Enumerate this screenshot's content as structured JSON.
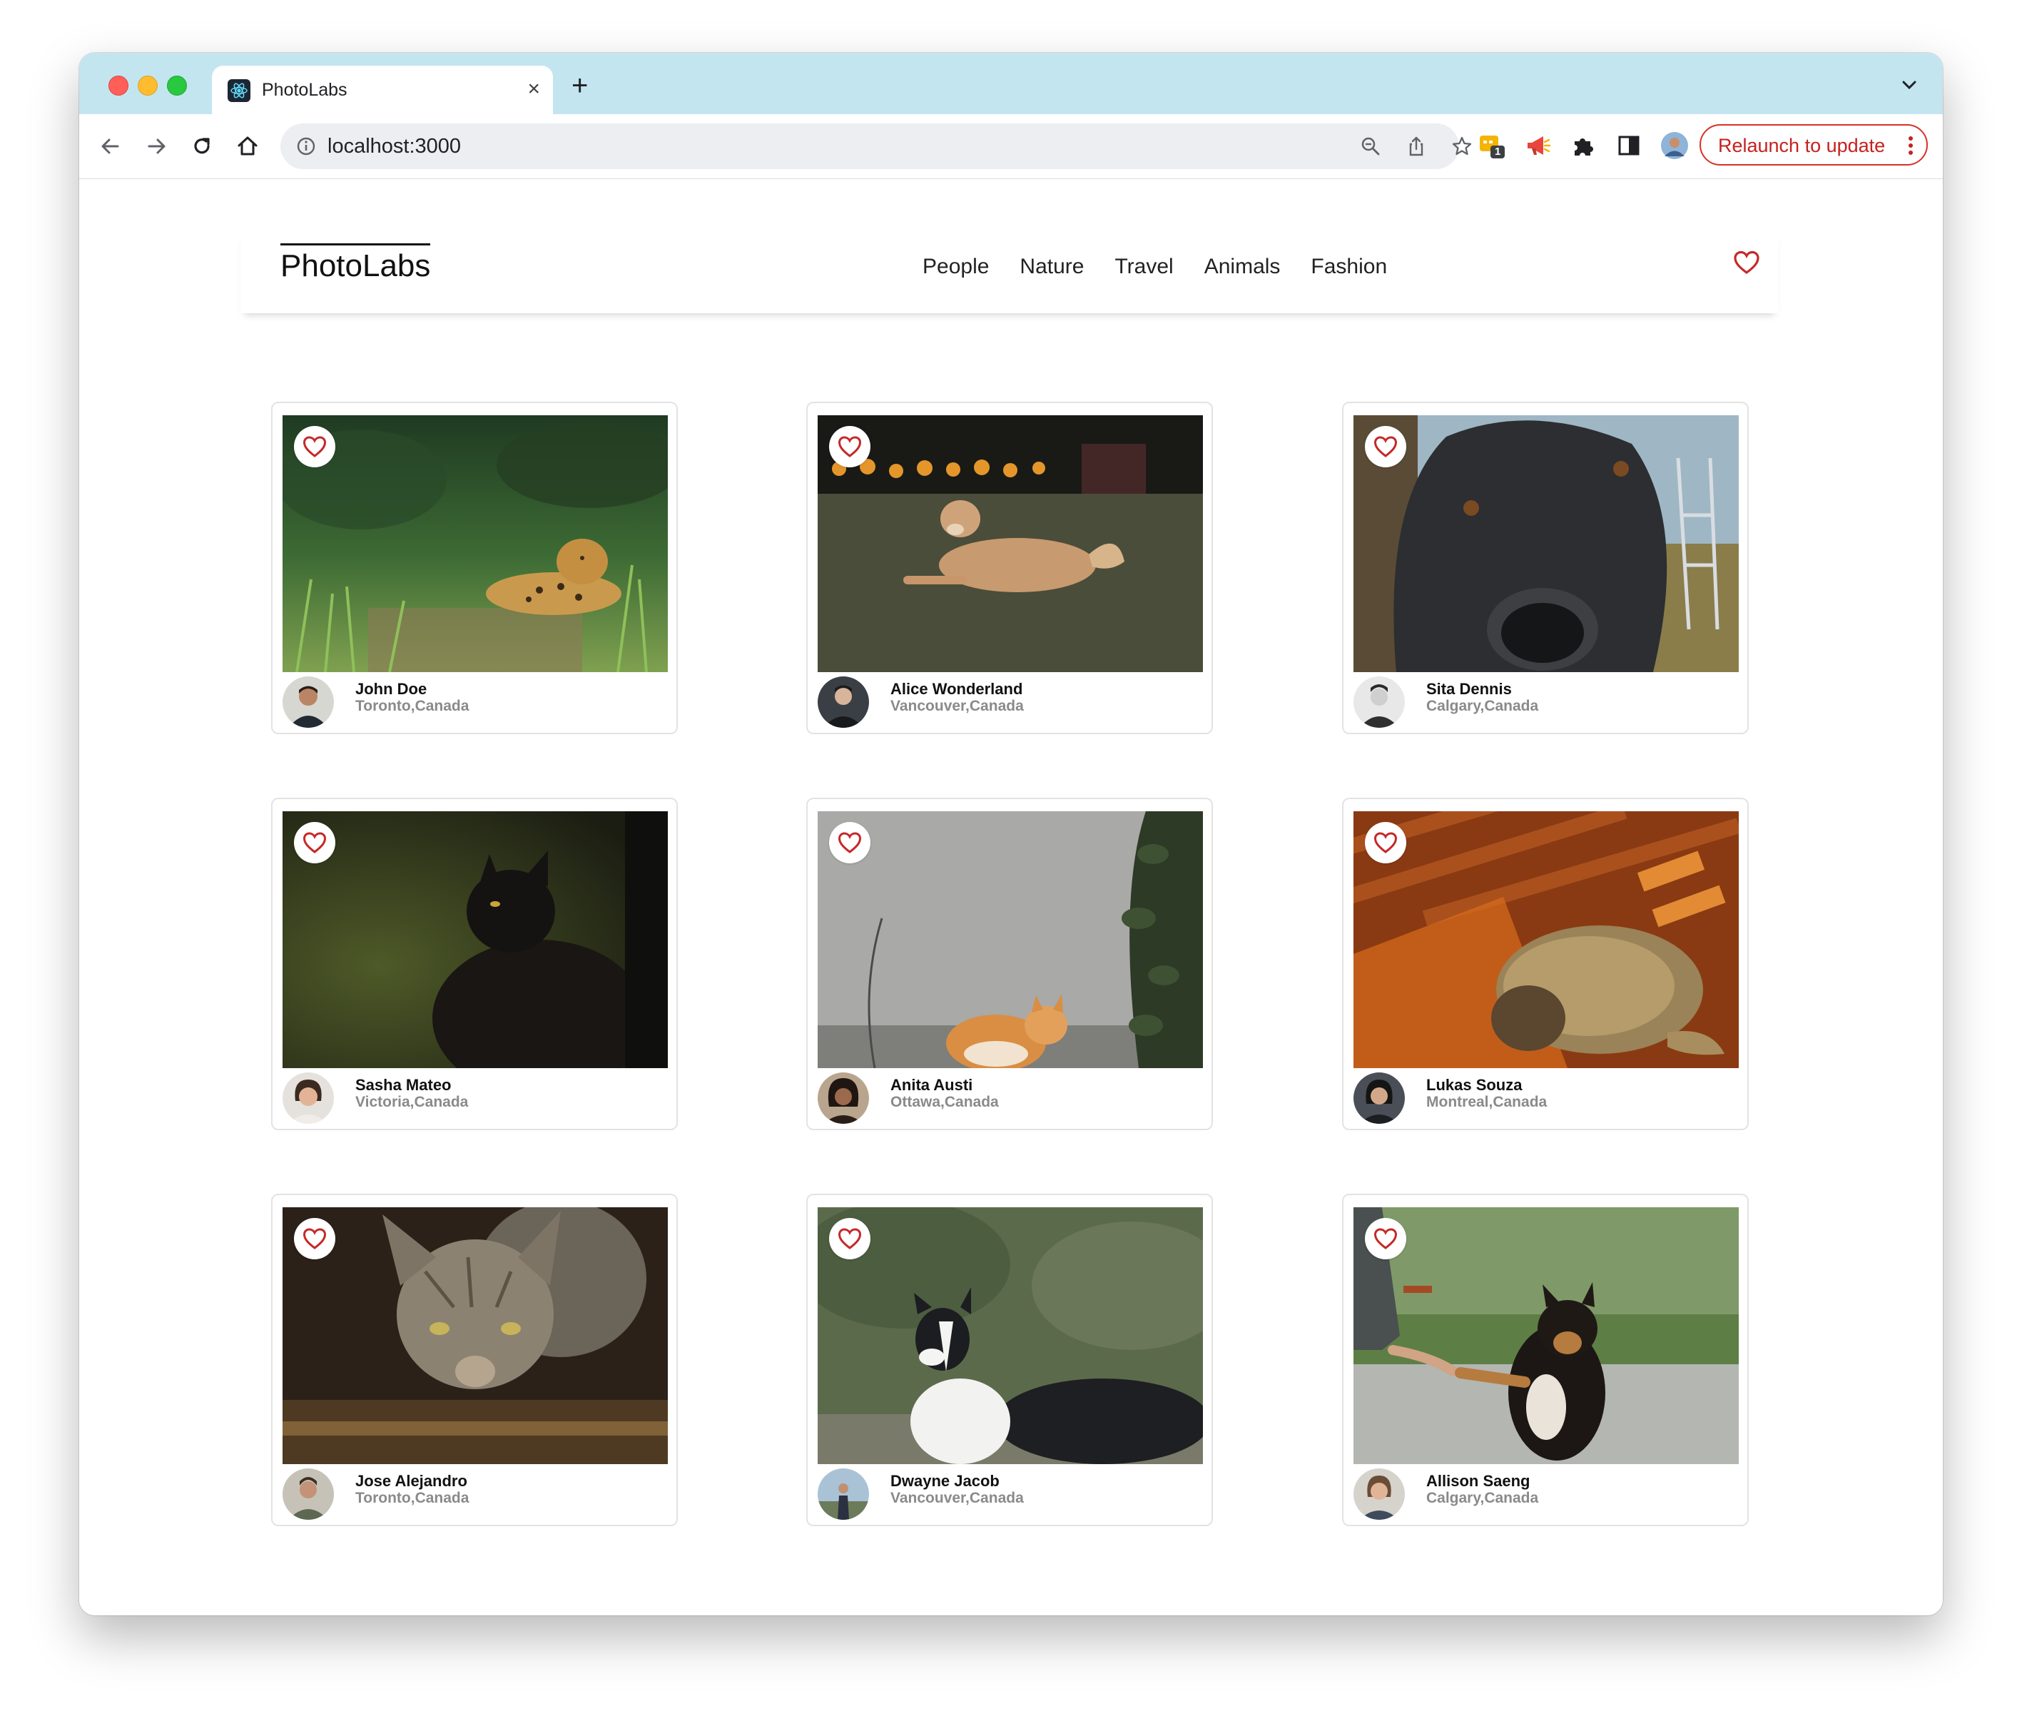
{
  "browser": {
    "tab_title": "PhotoLabs",
    "tab_close": "×",
    "new_tab": "+",
    "url": "localhost:3000",
    "relaunch_label": "Relaunch to update",
    "extension_badge": "1"
  },
  "app": {
    "logo": "PhotoLabs",
    "topics": [
      "People",
      "Nature",
      "Travel",
      "Animals",
      "Fashion"
    ],
    "accent_color": "#c62828"
  },
  "photos": [
    {
      "name": "John Doe",
      "location": "Toronto,Canada",
      "subject": "jaguar"
    },
    {
      "name": "Alice Wonderland",
      "location": "Vancouver,Canada",
      "subject": "dog"
    },
    {
      "name": "Sita Dennis",
      "location": "Calgary,Canada",
      "subject": "black dog"
    },
    {
      "name": "Sasha Mateo",
      "location": "Victoria,Canada",
      "subject": "black cat"
    },
    {
      "name": "Anita Austi",
      "location": "Ottawa,Canada",
      "subject": "orange cat"
    },
    {
      "name": "Lukas Souza",
      "location": "Montreal,Canada",
      "subject": "sleeping cat"
    },
    {
      "name": "Jose Alejandro",
      "location": "Toronto,Canada",
      "subject": "tabby cat"
    },
    {
      "name": "Dwayne Jacob",
      "location": "Vancouver,Canada",
      "subject": "border collie"
    },
    {
      "name": "Allison Saeng",
      "location": "Calgary,Canada",
      "subject": "dog giving paw"
    }
  ]
}
